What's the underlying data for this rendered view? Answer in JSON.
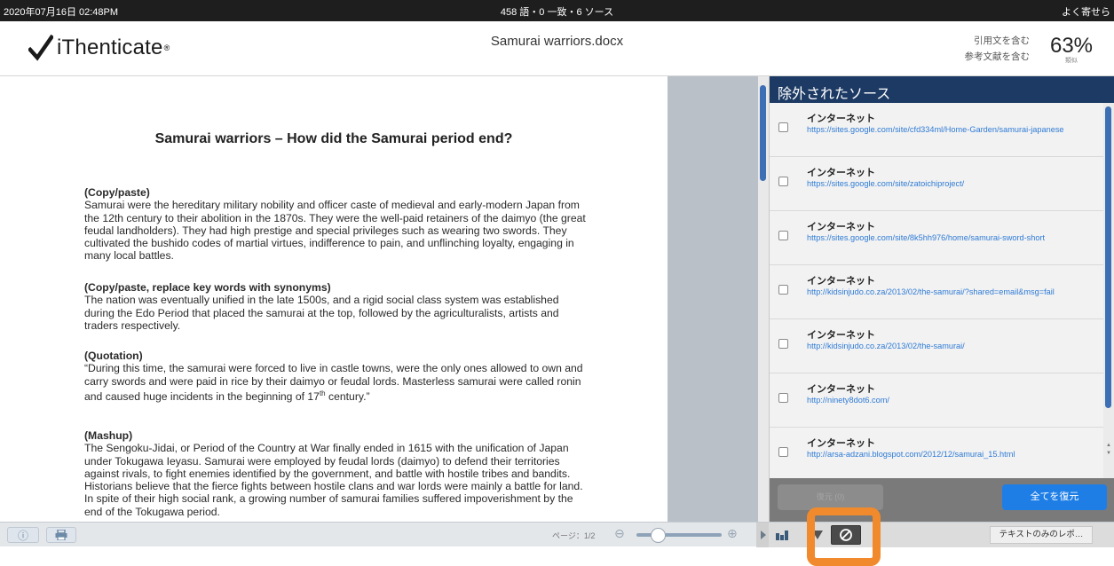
{
  "topbar": {
    "datetime": "2020年07月16日 02:48PM",
    "stats": "458 語・0 一致・6 ソース",
    "right_text": "よく寄せら"
  },
  "header": {
    "logo_text": "iThenticate",
    "logo_mark": "®",
    "doc_title": "Samurai warriors.docx",
    "filter_quotes": "引用文を含む",
    "filter_bibliography": "参考文献を含む",
    "similarity_score": "63%",
    "similarity_label": "類似"
  },
  "document": {
    "heading": "Samurai warriors – How did the Samurai period end?",
    "paragraphs": [
      {
        "heading": "(Copy/paste)",
        "body": "Samurai were the hereditary military nobility and officer caste of medieval and early-modern Japan from the 12th century to their abolition in the 1870s. They were the well-paid retainers of the daimyo (the great feudal landholders). They had high prestige and special privileges such as wearing two swords. They cultivated the bushido codes of martial virtues, indifference to pain, and unflinching loyalty, engaging in many local battles."
      },
      {
        "heading": "(Copy/paste, replace key words with synonyms)",
        "body": "The nation was eventually unified in the late 1500s, and a rigid social class system was established during the Edo Period that placed the samurai at the top, followed by the agriculturalists, artists and traders respectively."
      },
      {
        "heading": "(Quotation)",
        "body_before": "“During this time, the samurai were forced to live in castle towns, were the only ones allowed to own and carry swords and were paid in rice by their daimyo or feudal lords. Masterless samurai were called ronin and caused huge incidents in the beginning of 17",
        "superscript": "th",
        "body_after": " century.”"
      },
      {
        "heading": "(Mashup)",
        "body": "The Sengoku-Jidai, or Period of the Country at War finally ended in 1615 with the unification of Japan under Tokugawa Ieyasu. Samurai were employed by feudal lords (daimyo) to defend their territories against rivals, to fight enemies identified by the government, and battle with hostile tribes and bandits. Historians believe that the fierce fights between hostile clans and war lords were mainly a battle for land. In spite of their high social rank, a growing number of samurai families suffered impoverishment by the end of the Tokugawa period."
      }
    ]
  },
  "sidebar": {
    "title": "除外されたソース",
    "sources": [
      {
        "type": "インターネット",
        "url": "https://sites.google.com/site/cfd334ml/Home-Garden/samurai-japanese",
        "checked": false
      },
      {
        "type": "インターネット",
        "url": "https://sites.google.com/site/zatoichiproject/",
        "checked": false
      },
      {
        "type": "インターネット",
        "url": "https://sites.google.com/site/8k5hh976/home/samurai-sword-short",
        "checked": false
      },
      {
        "type": "インターネット",
        "url": "http://kidsinjudo.co.za/2013/02/the-samurai/?shared=email&msg=fail",
        "checked": false
      },
      {
        "type": "インターネット",
        "url": "http://kidsinjudo.co.za/2013/02/the-samurai/",
        "checked": false
      },
      {
        "type": "インターネット",
        "url": "http://ninety8dot6.com/",
        "checked": false
      },
      {
        "type": "インターネット",
        "url": "http://arsa-adzani.blogspot.com/2012/12/samurai_15.html",
        "checked": false
      }
    ],
    "left_button": "復元 (0)",
    "restore_all": "全てを復元"
  },
  "bottombar": {
    "page_indicator": "ページ：1/2",
    "text_only_report": "テキストのみのレポ…",
    "zoom_out_icon": "⊖",
    "zoom_in_icon": "⊕"
  },
  "colors": {
    "topbar": "#1e1e1e",
    "sidebar_header": "#1c3a63",
    "link": "#2e7bd6",
    "accent_button": "#1e7ee6",
    "highlight": "#f08a2c"
  }
}
